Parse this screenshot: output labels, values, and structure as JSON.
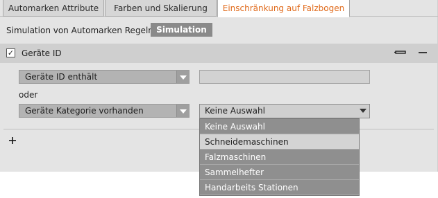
{
  "tabs": [
    {
      "label": "Automarken Attribute"
    },
    {
      "label": "Farben und Skalierung"
    },
    {
      "label": "Einschränkung auf Falzbogen",
      "active": true
    }
  ],
  "simulation": {
    "label": "Simulation von Automarken Regeln:",
    "button": "Simulation"
  },
  "group": {
    "title": "Geräte ID",
    "checked": true,
    "collapse_icon": "collapse-icon",
    "remove_icon": "minus-icon"
  },
  "rule1": {
    "field": "Geräte ID enthält",
    "value": ""
  },
  "connector": "oder",
  "rule2": {
    "field": "Geräte Kategorie vorhanden",
    "value": "Keine Auswahl"
  },
  "dropdown": {
    "options": [
      "Keine Auswahl",
      "Schneidemaschinen",
      "Falzmaschinen",
      "Sammelhefter",
      "Handarbeits Stationen"
    ],
    "highlighted": "Schneidemaschinen"
  },
  "add_icon": "plus-icon",
  "colors": {
    "active_tab": "#e06a1b",
    "button_bg": "#8a8a8a",
    "dropdown_bg": "#8f8f8f"
  }
}
